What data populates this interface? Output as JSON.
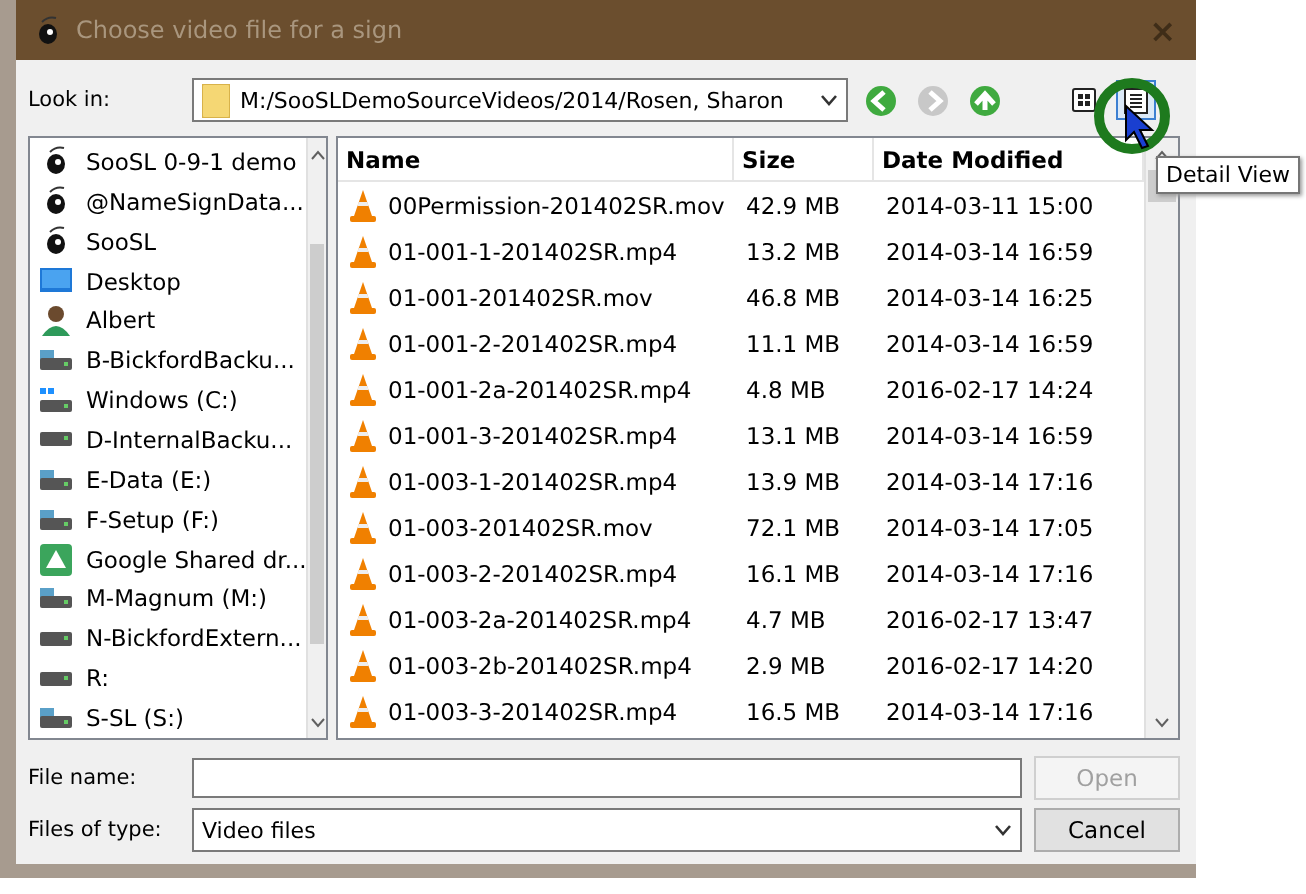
{
  "window": {
    "title": "Choose video file for a sign",
    "close": "×"
  },
  "look_in": {
    "label": "Look in:",
    "value": "M:/SooSLDemoSourceVideos/2014/Rosen, Sharon"
  },
  "nav_buttons": [
    {
      "kind": "back",
      "disabled": false
    },
    {
      "kind": "forward",
      "disabled": true
    },
    {
      "kind": "up",
      "disabled": false
    }
  ],
  "view_buttons": [
    {
      "kind": "list",
      "selected": false
    },
    {
      "kind": "detail",
      "selected": true
    }
  ],
  "tooltip": "Detail View",
  "sidebar": {
    "items": [
      {
        "label": "SooSL 0-9-1 demo",
        "kind": "app"
      },
      {
        "label": "@NameSignData...",
        "kind": "app"
      },
      {
        "label": "SooSL",
        "kind": "app"
      },
      {
        "label": "Desktop",
        "kind": "desktop"
      },
      {
        "label": "Albert",
        "kind": "user"
      },
      {
        "label": "B-BickfordBacku...",
        "kind": "netdrive"
      },
      {
        "label": "Windows (C:)",
        "kind": "windrive"
      },
      {
        "label": "D-InternalBacku...",
        "kind": "drive"
      },
      {
        "label": "E-Data (E:)",
        "kind": "netdrive"
      },
      {
        "label": "F-Setup (F:)",
        "kind": "netdrive"
      },
      {
        "label": "Google Shared dr...",
        "kind": "cloud"
      },
      {
        "label": "M-Magnum (M:)",
        "kind": "netdrive"
      },
      {
        "label": "N-BickfordExtern...",
        "kind": "drive"
      },
      {
        "label": "R:",
        "kind": "drive"
      },
      {
        "label": "S-SL (S:)",
        "kind": "netdrive"
      }
    ]
  },
  "table": {
    "columns": [
      "Name",
      "Size",
      "Date Modified"
    ],
    "rows": [
      [
        "00Permission-201402SR.mov",
        "42.9 MB",
        "2014-03-11 15:00"
      ],
      [
        "01-001-1-201402SR.mp4",
        "13.2 MB",
        "2014-03-14 16:59"
      ],
      [
        "01-001-201402SR.mov",
        "46.8 MB",
        "2014-03-14 16:25"
      ],
      [
        "01-001-2-201402SR.mp4",
        "11.1 MB",
        "2014-03-14 16:59"
      ],
      [
        "01-001-2a-201402SR.mp4",
        "4.8 MB",
        "2016-02-17 14:24"
      ],
      [
        "01-001-3-201402SR.mp4",
        "13.1 MB",
        "2014-03-14 16:59"
      ],
      [
        "01-003-1-201402SR.mp4",
        "13.9 MB",
        "2014-03-14 17:16"
      ],
      [
        "01-003-201402SR.mov",
        "72.1 MB",
        "2014-03-14 17:05"
      ],
      [
        "01-003-2-201402SR.mp4",
        "16.1 MB",
        "2014-03-14 17:16"
      ],
      [
        "01-003-2a-201402SR.mp4",
        "4.7 MB",
        "2016-02-17 13:47"
      ],
      [
        "01-003-2b-201402SR.mp4",
        "2.9 MB",
        "2016-02-17 14:20"
      ],
      [
        "01-003-3-201402SR.mp4",
        "16.5 MB",
        "2014-03-14 17:16"
      ]
    ]
  },
  "file_name": {
    "label": "File name:"
  },
  "files_of_type": {
    "label": "Files of type:",
    "value": "Video files"
  },
  "buttons": [
    {
      "label": "Open",
      "disabled": true
    },
    {
      "label": "Cancel",
      "disabled": false
    }
  ]
}
